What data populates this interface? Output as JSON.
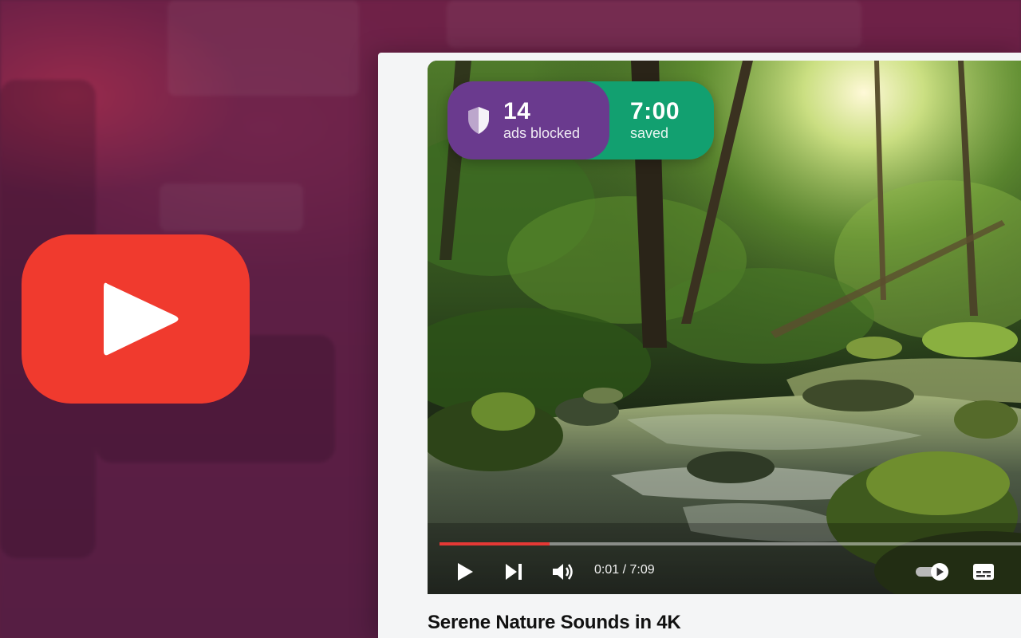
{
  "stats": {
    "ads_blocked_count": "14",
    "ads_blocked_label": "ads blocked",
    "time_saved": "7:00",
    "time_saved_label": "saved"
  },
  "player": {
    "current_time": "0:01",
    "duration": "7:09",
    "time_display": "0:01 / 7:09",
    "progress_fraction": 0.181
  },
  "video": {
    "title": "Serene Nature Sounds in 4K"
  },
  "colors": {
    "brand_red": "#f03a2e",
    "blocked_purple": "#6a3a8e",
    "saved_green": "#12a070",
    "progress_red": "#e53935"
  },
  "icons": {
    "logo": "youtube-play-icon",
    "shield": "shield-icon",
    "play": "play-icon",
    "next": "skip-next-icon",
    "volume": "volume-icon",
    "autoplay": "autoplay-toggle-icon",
    "captions": "captions-icon"
  }
}
